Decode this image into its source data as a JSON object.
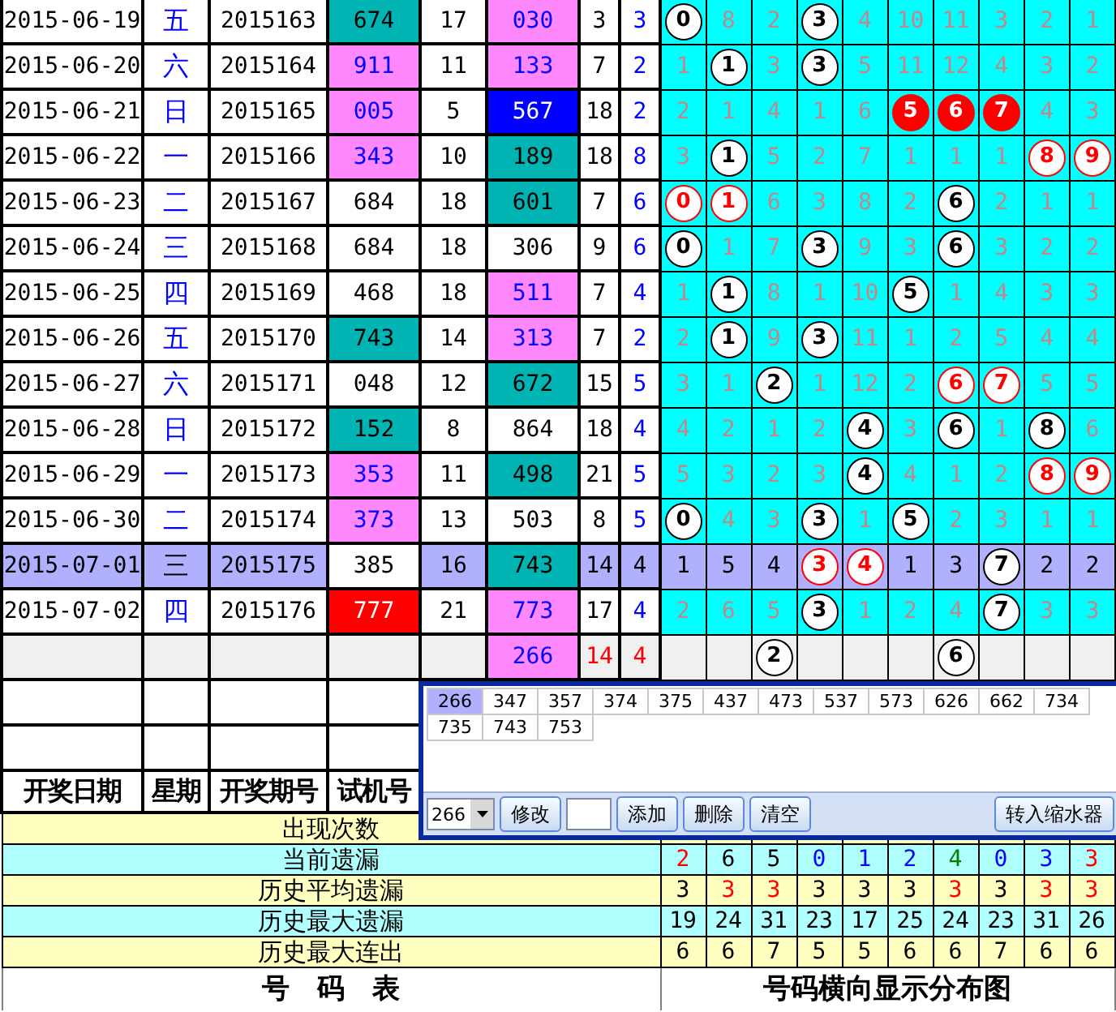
{
  "rows": [
    {
      "date": "2015-06-19",
      "weekday": "五",
      "issue": "2015163",
      "test": {
        "value": "674",
        "kind": "half-run"
      },
      "test_sum": "17",
      "draw": {
        "value": "030",
        "kind": "pair"
      },
      "sum": "3",
      "span": "3",
      "selected": false,
      "cells": [
        {
          "value": "0",
          "kind": "ball"
        },
        {
          "value": "8",
          "kind": "miss"
        },
        {
          "value": "2",
          "kind": "miss"
        },
        {
          "value": "3",
          "kind": "ball"
        },
        {
          "value": "4",
          "kind": "miss"
        },
        {
          "value": "10",
          "kind": "miss"
        },
        {
          "value": "11",
          "kind": "miss"
        },
        {
          "value": "3",
          "kind": "miss"
        },
        {
          "value": "2",
          "kind": "miss"
        },
        {
          "value": "1",
          "kind": "miss"
        }
      ]
    },
    {
      "date": "2015-06-20",
      "weekday": "六",
      "issue": "2015164",
      "test": {
        "value": "911",
        "kind": "pair"
      },
      "test_sum": "11",
      "draw": {
        "value": "133",
        "kind": "pair"
      },
      "sum": "7",
      "span": "2",
      "selected": false,
      "cells": [
        {
          "value": "1",
          "kind": "miss"
        },
        {
          "value": "1",
          "kind": "ball"
        },
        {
          "value": "3",
          "kind": "miss"
        },
        {
          "value": "3",
          "kind": "ball"
        },
        {
          "value": "5",
          "kind": "miss"
        },
        {
          "value": "11",
          "kind": "miss"
        },
        {
          "value": "12",
          "kind": "miss"
        },
        {
          "value": "4",
          "kind": "miss"
        },
        {
          "value": "3",
          "kind": "miss"
        },
        {
          "value": "2",
          "kind": "miss"
        }
      ]
    },
    {
      "date": "2015-06-21",
      "weekday": "日",
      "issue": "2015165",
      "test": {
        "value": "005",
        "kind": "pair"
      },
      "test_sum": "5",
      "draw": {
        "value": "567",
        "kind": "run"
      },
      "sum": "18",
      "span": "2",
      "selected": false,
      "cells": [
        {
          "value": "2",
          "kind": "miss"
        },
        {
          "value": "1",
          "kind": "miss"
        },
        {
          "value": "4",
          "kind": "miss"
        },
        {
          "value": "1",
          "kind": "miss"
        },
        {
          "value": "6",
          "kind": "miss"
        },
        {
          "value": "5",
          "kind": "red-ball"
        },
        {
          "value": "6",
          "kind": "red-ball"
        },
        {
          "value": "7",
          "kind": "red-ball"
        },
        {
          "value": "4",
          "kind": "miss"
        },
        {
          "value": "3",
          "kind": "miss"
        }
      ]
    },
    {
      "date": "2015-06-22",
      "weekday": "一",
      "issue": "2015166",
      "test": {
        "value": "343",
        "kind": "pair"
      },
      "test_sum": "10",
      "draw": {
        "value": "189",
        "kind": "half-run"
      },
      "sum": "18",
      "span": "8",
      "selected": false,
      "cells": [
        {
          "value": "3",
          "kind": "miss"
        },
        {
          "value": "1",
          "kind": "ball"
        },
        {
          "value": "5",
          "kind": "miss"
        },
        {
          "value": "2",
          "kind": "miss"
        },
        {
          "value": "7",
          "kind": "miss"
        },
        {
          "value": "1",
          "kind": "miss"
        },
        {
          "value": "1",
          "kind": "miss"
        },
        {
          "value": "1",
          "kind": "miss"
        },
        {
          "value": "8",
          "kind": "red-ring"
        },
        {
          "value": "9",
          "kind": "red-ring"
        }
      ]
    },
    {
      "date": "2015-06-23",
      "weekday": "二",
      "issue": "2015167",
      "test": {
        "value": "684",
        "kind": "plain"
      },
      "test_sum": "18",
      "draw": {
        "value": "601",
        "kind": "half-run"
      },
      "sum": "7",
      "span": "6",
      "selected": false,
      "cells": [
        {
          "value": "0",
          "kind": "red-ring"
        },
        {
          "value": "1",
          "kind": "red-ring"
        },
        {
          "value": "6",
          "kind": "miss"
        },
        {
          "value": "3",
          "kind": "miss"
        },
        {
          "value": "8",
          "kind": "miss"
        },
        {
          "value": "2",
          "kind": "miss"
        },
        {
          "value": "6",
          "kind": "ball"
        },
        {
          "value": "2",
          "kind": "miss"
        },
        {
          "value": "1",
          "kind": "miss"
        },
        {
          "value": "1",
          "kind": "miss"
        }
      ]
    },
    {
      "date": "2015-06-24",
      "weekday": "三",
      "issue": "2015168",
      "test": {
        "value": "684",
        "kind": "plain"
      },
      "test_sum": "18",
      "draw": {
        "value": "306",
        "kind": "plain"
      },
      "sum": "9",
      "span": "6",
      "selected": false,
      "cells": [
        {
          "value": "0",
          "kind": "ball"
        },
        {
          "value": "1",
          "kind": "miss"
        },
        {
          "value": "7",
          "kind": "miss"
        },
        {
          "value": "3",
          "kind": "ball"
        },
        {
          "value": "9",
          "kind": "miss"
        },
        {
          "value": "3",
          "kind": "miss"
        },
        {
          "value": "6",
          "kind": "ball"
        },
        {
          "value": "3",
          "kind": "miss"
        },
        {
          "value": "2",
          "kind": "miss"
        },
        {
          "value": "2",
          "kind": "miss"
        }
      ]
    },
    {
      "date": "2015-06-25",
      "weekday": "四",
      "issue": "2015169",
      "test": {
        "value": "468",
        "kind": "plain"
      },
      "test_sum": "18",
      "draw": {
        "value": "511",
        "kind": "pair"
      },
      "sum": "7",
      "span": "4",
      "selected": false,
      "cells": [
        {
          "value": "1",
          "kind": "miss"
        },
        {
          "value": "1",
          "kind": "ball"
        },
        {
          "value": "8",
          "kind": "miss"
        },
        {
          "value": "1",
          "kind": "miss"
        },
        {
          "value": "10",
          "kind": "miss"
        },
        {
          "value": "5",
          "kind": "ball"
        },
        {
          "value": "1",
          "kind": "miss"
        },
        {
          "value": "4",
          "kind": "miss"
        },
        {
          "value": "3",
          "kind": "miss"
        },
        {
          "value": "3",
          "kind": "miss"
        }
      ]
    },
    {
      "date": "2015-06-26",
      "weekday": "五",
      "issue": "2015170",
      "test": {
        "value": "743",
        "kind": "half-run"
      },
      "test_sum": "14",
      "draw": {
        "value": "313",
        "kind": "pair"
      },
      "sum": "7",
      "span": "2",
      "selected": false,
      "cells": [
        {
          "value": "2",
          "kind": "miss"
        },
        {
          "value": "1",
          "kind": "ball"
        },
        {
          "value": "9",
          "kind": "miss"
        },
        {
          "value": "3",
          "kind": "ball"
        },
        {
          "value": "11",
          "kind": "miss"
        },
        {
          "value": "1",
          "kind": "miss"
        },
        {
          "value": "2",
          "kind": "miss"
        },
        {
          "value": "5",
          "kind": "miss"
        },
        {
          "value": "4",
          "kind": "miss"
        },
        {
          "value": "4",
          "kind": "miss"
        }
      ]
    },
    {
      "date": "2015-06-27",
      "weekday": "六",
      "issue": "2015171",
      "test": {
        "value": "048",
        "kind": "plain"
      },
      "test_sum": "12",
      "draw": {
        "value": "672",
        "kind": "half-run"
      },
      "sum": "15",
      "span": "5",
      "selected": false,
      "cells": [
        {
          "value": "3",
          "kind": "miss"
        },
        {
          "value": "1",
          "kind": "miss"
        },
        {
          "value": "2",
          "kind": "ball"
        },
        {
          "value": "1",
          "kind": "miss"
        },
        {
          "value": "12",
          "kind": "miss"
        },
        {
          "value": "2",
          "kind": "miss"
        },
        {
          "value": "6",
          "kind": "red-ring"
        },
        {
          "value": "7",
          "kind": "red-ring"
        },
        {
          "value": "5",
          "kind": "miss"
        },
        {
          "value": "5",
          "kind": "miss"
        }
      ]
    },
    {
      "date": "2015-06-28",
      "weekday": "日",
      "issue": "2015172",
      "test": {
        "value": "152",
        "kind": "half-run"
      },
      "test_sum": "8",
      "draw": {
        "value": "864",
        "kind": "plain"
      },
      "sum": "18",
      "span": "4",
      "selected": false,
      "cells": [
        {
          "value": "4",
          "kind": "miss"
        },
        {
          "value": "2",
          "kind": "miss"
        },
        {
          "value": "1",
          "kind": "miss"
        },
        {
          "value": "2",
          "kind": "miss"
        },
        {
          "value": "4",
          "kind": "ball"
        },
        {
          "value": "3",
          "kind": "miss"
        },
        {
          "value": "6",
          "kind": "ball"
        },
        {
          "value": "1",
          "kind": "miss"
        },
        {
          "value": "8",
          "kind": "ball"
        },
        {
          "value": "6",
          "kind": "miss"
        }
      ]
    },
    {
      "date": "2015-06-29",
      "weekday": "一",
      "issue": "2015173",
      "test": {
        "value": "353",
        "kind": "pair"
      },
      "test_sum": "11",
      "draw": {
        "value": "498",
        "kind": "half-run"
      },
      "sum": "21",
      "span": "5",
      "selected": false,
      "cells": [
        {
          "value": "5",
          "kind": "miss"
        },
        {
          "value": "3",
          "kind": "miss"
        },
        {
          "value": "2",
          "kind": "miss"
        },
        {
          "value": "3",
          "kind": "miss"
        },
        {
          "value": "4",
          "kind": "ball"
        },
        {
          "value": "4",
          "kind": "miss"
        },
        {
          "value": "1",
          "kind": "miss"
        },
        {
          "value": "2",
          "kind": "miss"
        },
        {
          "value": "8",
          "kind": "red-ring"
        },
        {
          "value": "9",
          "kind": "red-ring"
        }
      ]
    },
    {
      "date": "2015-06-30",
      "weekday": "二",
      "issue": "2015174",
      "test": {
        "value": "373",
        "kind": "pair"
      },
      "test_sum": "13",
      "draw": {
        "value": "503",
        "kind": "plain"
      },
      "sum": "8",
      "span": "5",
      "selected": false,
      "cells": [
        {
          "value": "0",
          "kind": "ball"
        },
        {
          "value": "4",
          "kind": "miss"
        },
        {
          "value": "3",
          "kind": "miss"
        },
        {
          "value": "3",
          "kind": "ball"
        },
        {
          "value": "1",
          "kind": "miss"
        },
        {
          "value": "5",
          "kind": "ball"
        },
        {
          "value": "2",
          "kind": "miss"
        },
        {
          "value": "3",
          "kind": "miss"
        },
        {
          "value": "1",
          "kind": "miss"
        },
        {
          "value": "1",
          "kind": "miss"
        }
      ]
    },
    {
      "date": "2015-07-01",
      "weekday": "三",
      "issue": "2015175",
      "test": {
        "value": "385",
        "kind": "plain"
      },
      "test_sum": "16",
      "draw": {
        "value": "743",
        "kind": "half-run"
      },
      "sum": "14",
      "span": "4",
      "selected": true,
      "cells": [
        {
          "value": "1",
          "kind": "miss"
        },
        {
          "value": "5",
          "kind": "miss"
        },
        {
          "value": "4",
          "kind": "miss"
        },
        {
          "value": "3",
          "kind": "red-ring"
        },
        {
          "value": "4",
          "kind": "red-ring"
        },
        {
          "value": "1",
          "kind": "miss"
        },
        {
          "value": "3",
          "kind": "miss"
        },
        {
          "value": "7",
          "kind": "ball"
        },
        {
          "value": "2",
          "kind": "miss"
        },
        {
          "value": "2",
          "kind": "miss"
        }
      ]
    },
    {
      "date": "2015-07-02",
      "weekday": "四",
      "issue": "2015176",
      "test": {
        "value": "777",
        "kind": "triple"
      },
      "test_sum": "21",
      "draw": {
        "value": "773",
        "kind": "pair"
      },
      "sum": "17",
      "span": "4",
      "selected": false,
      "cells": [
        {
          "value": "2",
          "kind": "miss"
        },
        {
          "value": "6",
          "kind": "miss"
        },
        {
          "value": "5",
          "kind": "miss"
        },
        {
          "value": "3",
          "kind": "ball"
        },
        {
          "value": "1",
          "kind": "miss"
        },
        {
          "value": "2",
          "kind": "miss"
        },
        {
          "value": "4",
          "kind": "miss"
        },
        {
          "value": "7",
          "kind": "ball"
        },
        {
          "value": "3",
          "kind": "miss"
        },
        {
          "value": "3",
          "kind": "miss"
        }
      ]
    }
  ],
  "forecast": {
    "draw": {
      "value": "266",
      "kind": "pair"
    },
    "sum": "14",
    "span": "4",
    "cells": [
      {
        "kind": "blank"
      },
      {
        "kind": "blank"
      },
      {
        "value": "2",
        "kind": "ball"
      },
      {
        "kind": "blank"
      },
      {
        "kind": "blank"
      },
      {
        "kind": "blank"
      },
      {
        "value": "6",
        "kind": "ball"
      },
      {
        "kind": "blank"
      },
      {
        "kind": "blank"
      },
      {
        "kind": "blank"
      }
    ]
  },
  "headers": [
    "开奖日期",
    "星期",
    "开奖期号",
    "试机号"
  ],
  "stats": [
    {
      "label": "出现次数"
    },
    {
      "label": "当前遗漏",
      "values": [
        {
          "value": "2",
          "color": "#ff0000"
        },
        {
          "value": "6",
          "color": "#000000"
        },
        {
          "value": "5",
          "color": "#000000"
        },
        {
          "value": "0",
          "color": "#0000ff"
        },
        {
          "value": "1",
          "color": "#0000ff"
        },
        {
          "value": "2",
          "color": "#0000ff"
        },
        {
          "value": "4",
          "color": "#008000"
        },
        {
          "value": "0",
          "color": "#0000ff"
        },
        {
          "value": "3",
          "color": "#0000ff"
        },
        {
          "value": "3",
          "color": "#ff0000"
        }
      ]
    },
    {
      "label": "历史平均遗漏",
      "values": [
        {
          "value": "3",
          "color": "#000000"
        },
        {
          "value": "3",
          "color": "#ff0000"
        },
        {
          "value": "3",
          "color": "#ff0000"
        },
        {
          "value": "3",
          "color": "#000000"
        },
        {
          "value": "3",
          "color": "#000000"
        },
        {
          "value": "3",
          "color": "#000000"
        },
        {
          "value": "3",
          "color": "#ff0000"
        },
        {
          "value": "3",
          "color": "#000000"
        },
        {
          "value": "3",
          "color": "#ff0000"
        },
        {
          "value": "3",
          "color": "#ff0000"
        }
      ]
    },
    {
      "label": "历史最大遗漏",
      "values": [
        {
          "value": "19",
          "color": "#000000"
        },
        {
          "value": "24",
          "color": "#000000"
        },
        {
          "value": "31",
          "color": "#000000"
        },
        {
          "value": "23",
          "color": "#000000"
        },
        {
          "value": "17",
          "color": "#000000"
        },
        {
          "value": "25",
          "color": "#000000"
        },
        {
          "value": "24",
          "color": "#000000"
        },
        {
          "value": "23",
          "color": "#000000"
        },
        {
          "value": "31",
          "color": "#000000"
        },
        {
          "value": "26",
          "color": "#000000"
        }
      ]
    },
    {
      "label": "历史最大连出",
      "values": [
        {
          "value": "6",
          "color": "#000000"
        },
        {
          "value": "6",
          "color": "#000000"
        },
        {
          "value": "7",
          "color": "#000000"
        },
        {
          "value": "5",
          "color": "#000000"
        },
        {
          "value": "5",
          "color": "#000000"
        },
        {
          "value": "6",
          "color": "#000000"
        },
        {
          "value": "6",
          "color": "#000000"
        },
        {
          "value": "7",
          "color": "#000000"
        },
        {
          "value": "6",
          "color": "#000000"
        },
        {
          "value": "6",
          "color": "#000000"
        }
      ]
    }
  ],
  "footer": {
    "left": "号　码　表",
    "right": "号码横向显示分布图"
  },
  "dialog": {
    "numbers": [
      {
        "value": "266",
        "selected": true
      },
      {
        "value": "347",
        "selected": false
      },
      {
        "value": "357",
        "selected": false
      },
      {
        "value": "374",
        "selected": false
      },
      {
        "value": "375",
        "selected": false
      },
      {
        "value": "437",
        "selected": false
      },
      {
        "value": "473",
        "selected": false
      },
      {
        "value": "537",
        "selected": false
      },
      {
        "value": "573",
        "selected": false
      },
      {
        "value": "626",
        "selected": false
      },
      {
        "value": "662",
        "selected": false
      },
      {
        "value": "734",
        "selected": false
      },
      {
        "value": "735",
        "selected": false
      },
      {
        "value": "743",
        "selected": false
      },
      {
        "value": "753",
        "selected": false
      }
    ],
    "combo_value": "266",
    "edit_button": "修改",
    "buttons": [
      "添加",
      "删除",
      "清空"
    ],
    "transfer_button": "转入缩水器"
  }
}
